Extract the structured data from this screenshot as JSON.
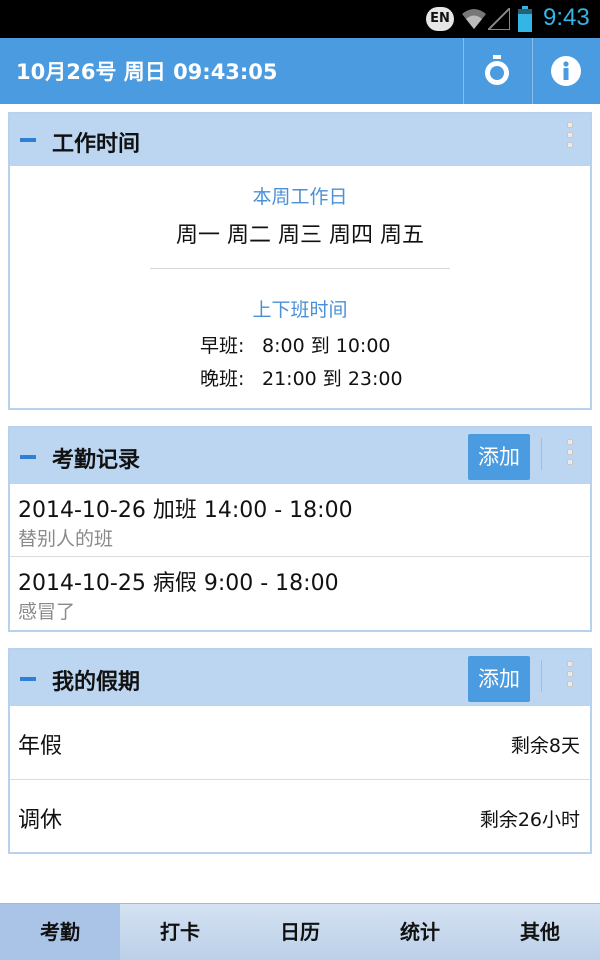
{
  "status_bar": {
    "keyboard": "EN",
    "time": "9:43"
  },
  "header": {
    "title": "10月26号 周日 09:43:05",
    "icons": [
      "clock-icon",
      "info-icon"
    ],
    "accent": "#4a9be0"
  },
  "work_time": {
    "title": "工作时间",
    "weekdays_label": "本周工作日",
    "weekdays": "周一 周二 周三 周四 周五",
    "shift_label": "上下班时间",
    "shifts": [
      {
        "name": "早班:",
        "time": "8:00 到 10:00"
      },
      {
        "name": "晚班:",
        "time": "21:00 到 23:00"
      }
    ]
  },
  "attendance": {
    "title": "考勤记录",
    "add_label": "添加",
    "records": [
      {
        "main": "2014-10-26 加班   14:00 - 18:00",
        "note": "替别人的班"
      },
      {
        "main": "2014-10-25 病假   9:00 - 18:00",
        "note": "感冒了"
      }
    ]
  },
  "holidays": {
    "title": "我的假期",
    "add_label": "添加",
    "items": [
      {
        "name": "年假",
        "remaining": "剩余8天"
      },
      {
        "name": "调休",
        "remaining": "剩余26小时"
      }
    ]
  },
  "tabs": [
    {
      "label": "考勤",
      "active": true
    },
    {
      "label": "打卡",
      "active": false
    },
    {
      "label": "日历",
      "active": false
    },
    {
      "label": "统计",
      "active": false
    },
    {
      "label": "其他",
      "active": false
    }
  ]
}
